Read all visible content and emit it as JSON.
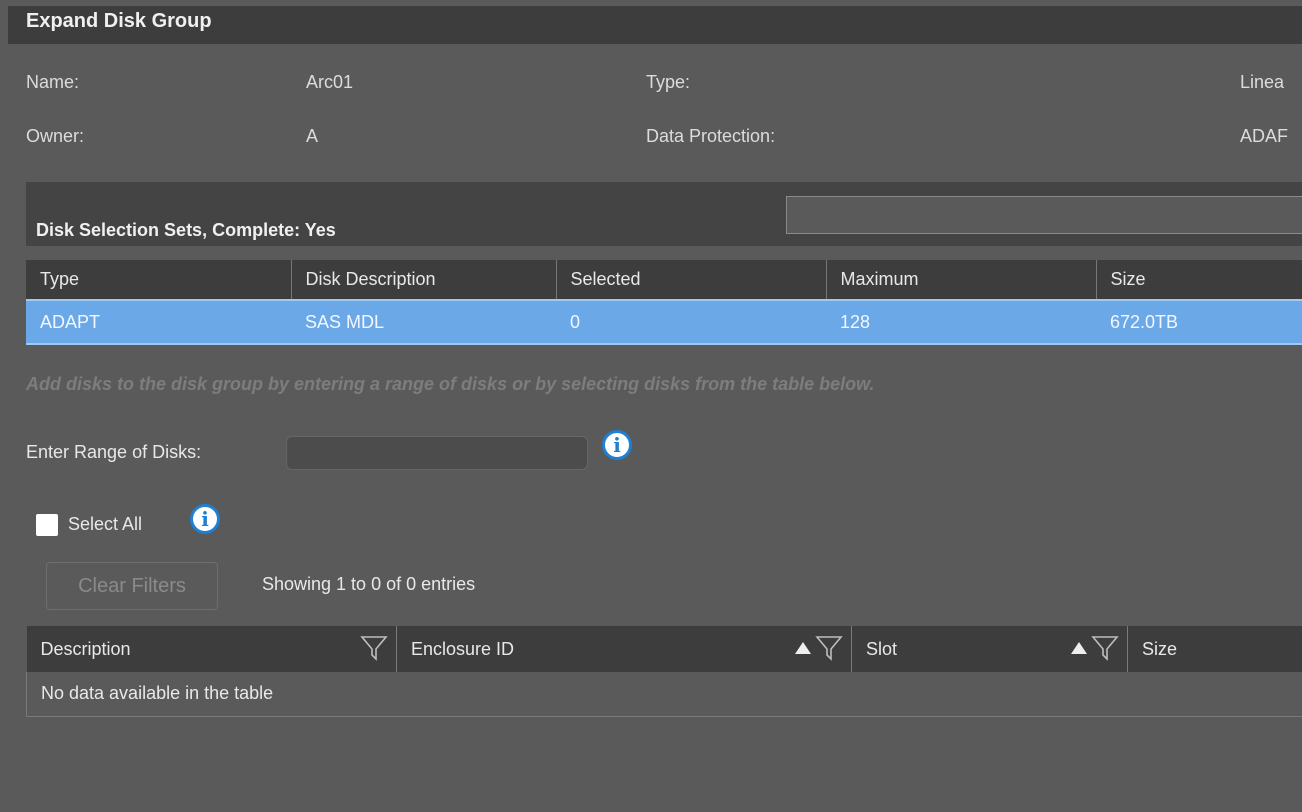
{
  "dialog": {
    "title": "Expand Disk Group"
  },
  "info": {
    "name_label": "Name:",
    "name_value": "Arc01",
    "type_label": "Type:",
    "type_value": "Linea",
    "owner_label": "Owner:",
    "owner_value": "A",
    "protection_label": "Data Protection:",
    "protection_value": "ADAF"
  },
  "sets": {
    "title": "Disk Selection Sets, Complete: Yes",
    "columns": [
      "Type",
      "Disk Description",
      "Selected",
      "Maximum",
      "Size"
    ],
    "rows": [
      [
        "ADAPT",
        "SAS MDL",
        "0",
        "128",
        "672.0TB"
      ]
    ]
  },
  "hint": "Add disks to the disk group by entering a range of disks or by selecting disks from the table below.",
  "range": {
    "label": "Enter Range of Disks:",
    "value": ""
  },
  "select_all": {
    "label": "Select All",
    "checked": false
  },
  "clear_filters": "Clear Filters",
  "showing": "Showing 1 to 0 of 0 entries",
  "disks": {
    "columns": [
      "Description",
      "Enclosure ID",
      "Slot",
      "Size"
    ],
    "empty": "No data available in the table"
  },
  "icons": {
    "info": "info-icon",
    "filter": "filter-icon",
    "sort": "sort-up-icon"
  },
  "colors": {
    "selected_row": "#6aa8e8",
    "header_bg": "#3d3d3d",
    "info_blue": "#1f7fd1"
  }
}
